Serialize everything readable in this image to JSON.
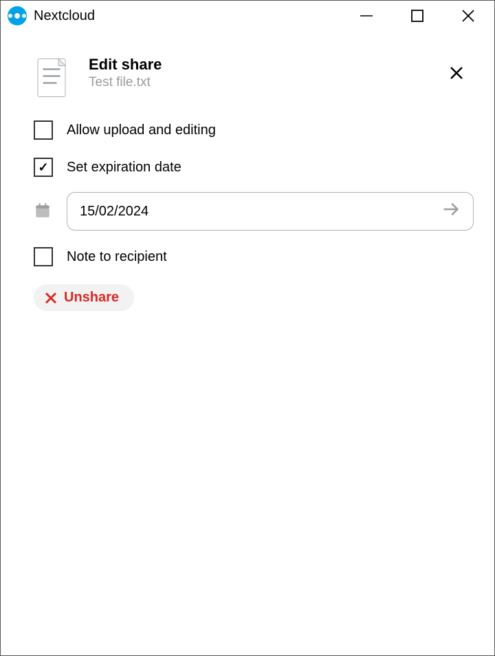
{
  "titlebar": {
    "app_name": "Nextcloud"
  },
  "header": {
    "title": "Edit share",
    "filename": "Test file.txt"
  },
  "options": {
    "allow_upload": {
      "label": "Allow upload and editing",
      "checked": false
    },
    "set_expiration": {
      "label": "Set expiration date",
      "checked": true,
      "check_glyph": "✓"
    },
    "note_recipient": {
      "label": "Note to recipient",
      "checked": false
    }
  },
  "date_input": {
    "value": "15/02/2024"
  },
  "unshare": {
    "label": "Unshare"
  },
  "colors": {
    "brand": "#00a2e8",
    "danger": "#d92a26"
  }
}
